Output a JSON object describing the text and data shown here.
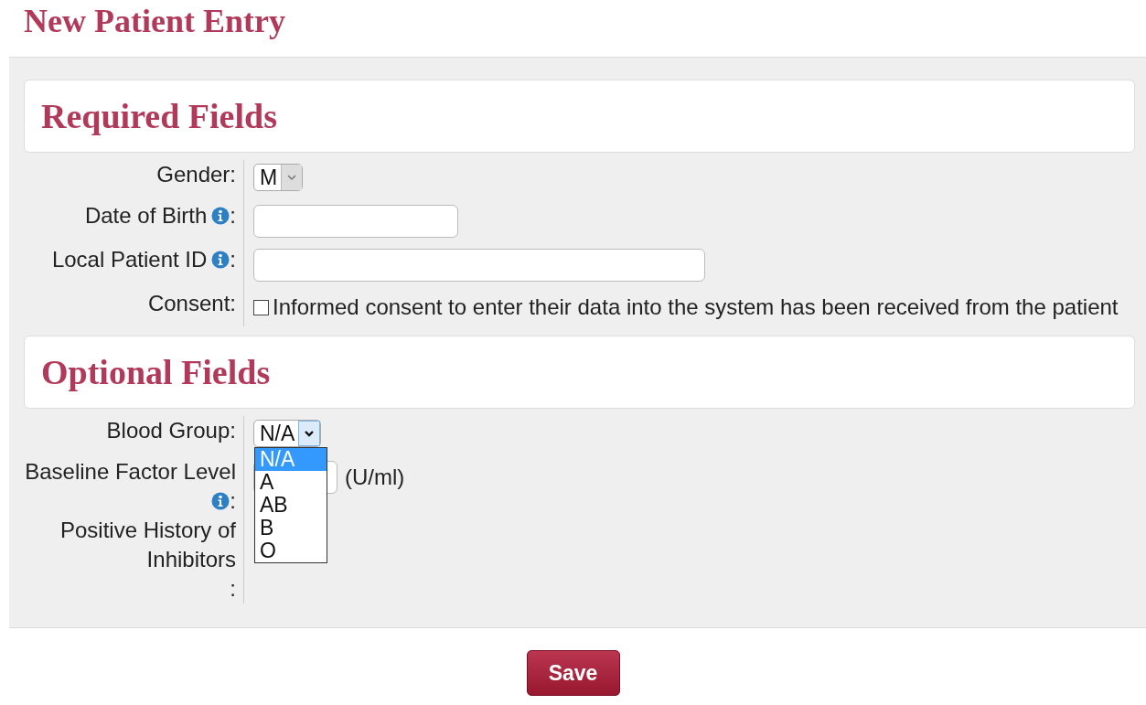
{
  "title": "New Patient Entry",
  "sections": [
    {
      "heading": "Required Fields",
      "rows": [
        {
          "kind": "select",
          "label": "Gender",
          "info": false,
          "punct": ":",
          "value": "M",
          "open": false
        },
        {
          "kind": "date",
          "label": "Date of Birth",
          "info": true,
          "punct": ":"
        },
        {
          "kind": "text",
          "label": "Local Patient ID",
          "info": true,
          "punct": ":"
        },
        {
          "kind": "checkbox",
          "label": "Consent",
          "info": false,
          "punct": ":",
          "checked": false,
          "text": "Informed consent to enter their data into the system has been received from the patient"
        }
      ]
    },
    {
      "heading": "Optional Fields",
      "rows": [
        {
          "kind": "select",
          "label": "Blood Group",
          "info": false,
          "punct": ":",
          "value": "N/A",
          "open": true,
          "options": [
            {
              "label": "N/A",
              "selected": true
            },
            {
              "label": "A",
              "selected": false
            },
            {
              "label": "AB",
              "selected": false
            },
            {
              "label": "B",
              "selected": false
            },
            {
              "label": "O",
              "selected": false
            }
          ]
        },
        {
          "kind": "unit",
          "label": "Baseline Factor Level",
          "info": true,
          "punct": ":",
          "unit": "(U/ml)"
        },
        {
          "kind": "hidden",
          "label": "Positive History of Inhibitors",
          "info": false,
          "punct": ":"
        }
      ]
    }
  ],
  "save": "Save"
}
